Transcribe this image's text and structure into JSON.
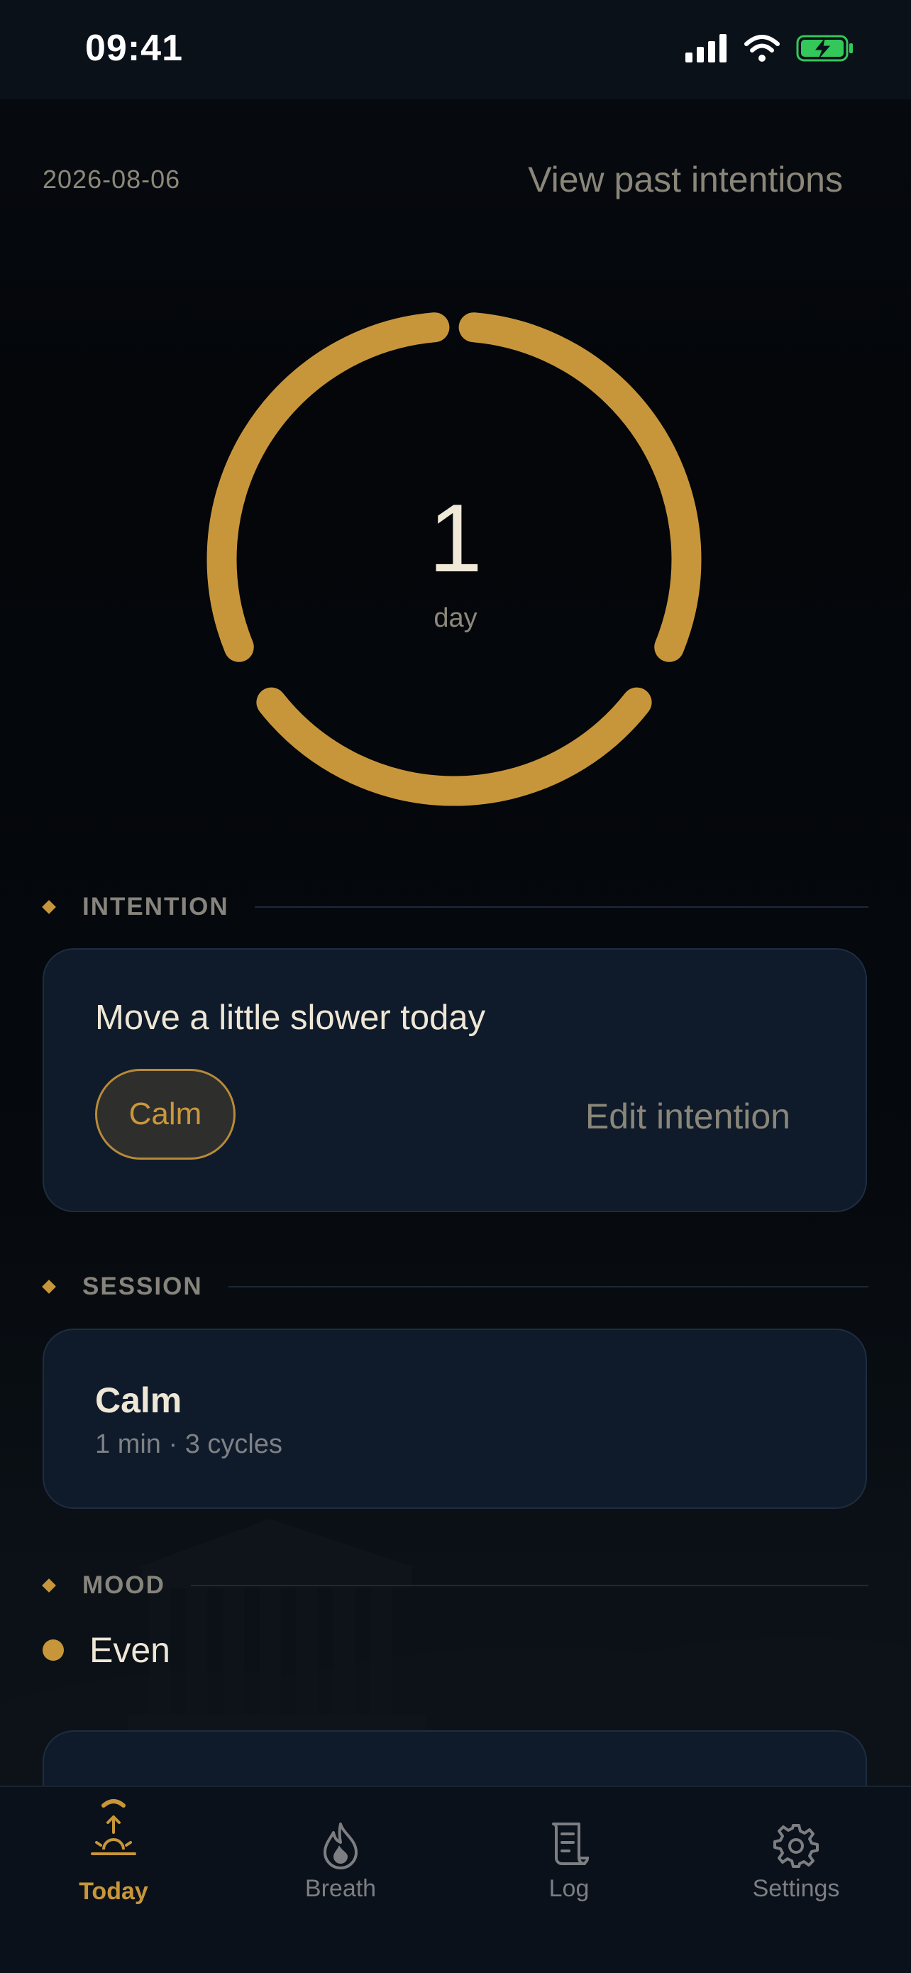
{
  "status_bar": {
    "time": "09:41"
  },
  "header": {
    "date": "2026-08-06",
    "past_link": "View past intentions"
  },
  "streak": {
    "count": "1",
    "unit": "day"
  },
  "sections": {
    "intention": "INTENTION",
    "session": "SESSION",
    "mood": "MOOD"
  },
  "intention": {
    "text": "Move a little slower today",
    "chip": "Calm",
    "edit_label": "Edit intention"
  },
  "session": {
    "title": "Calm",
    "meta": "1 min · 3 cycles"
  },
  "mood": {
    "label": "Even"
  },
  "tabs": [
    {
      "label": "Today",
      "icon": "sunrise-icon",
      "active": true
    },
    {
      "label": "Breath",
      "icon": "flame-icon",
      "active": false
    },
    {
      "label": "Log",
      "icon": "scroll-icon",
      "active": false
    },
    {
      "label": "Settings",
      "icon": "gear-icon",
      "active": false
    }
  ],
  "colors": {
    "accent": "#c8963a",
    "background": "#05080c",
    "card": "#0f1b2a",
    "text": "#efe7d6",
    "muted": "#8a8679"
  }
}
